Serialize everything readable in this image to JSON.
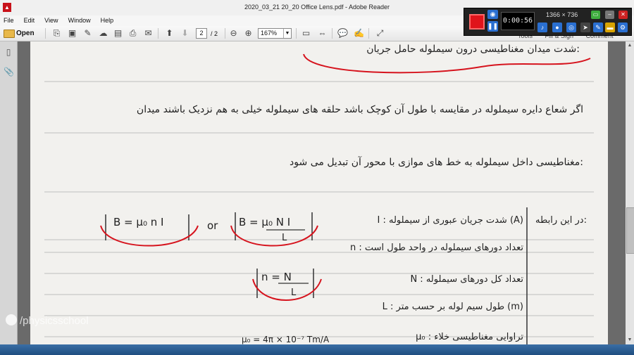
{
  "window": {
    "title": "2020_03_21 20_20 Office Lens.pdf - Adobe Reader",
    "app_icon": "pdf-icon"
  },
  "menu": [
    "File",
    "Edit",
    "View",
    "Window",
    "Help"
  ],
  "toolbar": {
    "open_label": "Open",
    "page_current": "2",
    "page_total": "/ 2",
    "zoom": "167%",
    "tools_label": "Tools",
    "fill_sign_label": "Fill & Sign",
    "comment_label": "Comment"
  },
  "recorder": {
    "timer": "0:00:56",
    "resolution": "1366 × 736"
  },
  "watermark": {
    "text": "/physicsschool"
  },
  "document": {
    "line_1": "شدت میدان مغناطیسی درون سیملوله حامل جریان:",
    "line_2": "اگر شعاع دایره سیملوله در مقایسه با طول آن کوچک باشد حلقه های سیملوله خیلی به هم نزدیک باشند میدان",
    "line_3": "مغناطیسی داخل سیملوله به خط های موازی با محور آن تبدیل می شود:",
    "formula_1_text": "B = μ₀ n I",
    "or_text": "or",
    "formula_2_num": "B = μ₀ N I",
    "formula_2_den": "L",
    "defs_title": "در این رابطه:",
    "def_I": "I : شدت جریان عبوری از سیملوله (A)",
    "def_n": "n : تعداد دورهای سیملوله در واحد طول است",
    "def_N": "N : تعداد کل دورهای سیملوله",
    "def_L": "L : طول سیم لوله بر حسب متر (m)",
    "def_mu": "μ₀ : تراوایی مغناطیسی خلاء",
    "formula_3_num": "n = N",
    "formula_3_den": "L",
    "mu_value": "μ₀ = 4π × 10⁻⁷ Tm/A"
  }
}
